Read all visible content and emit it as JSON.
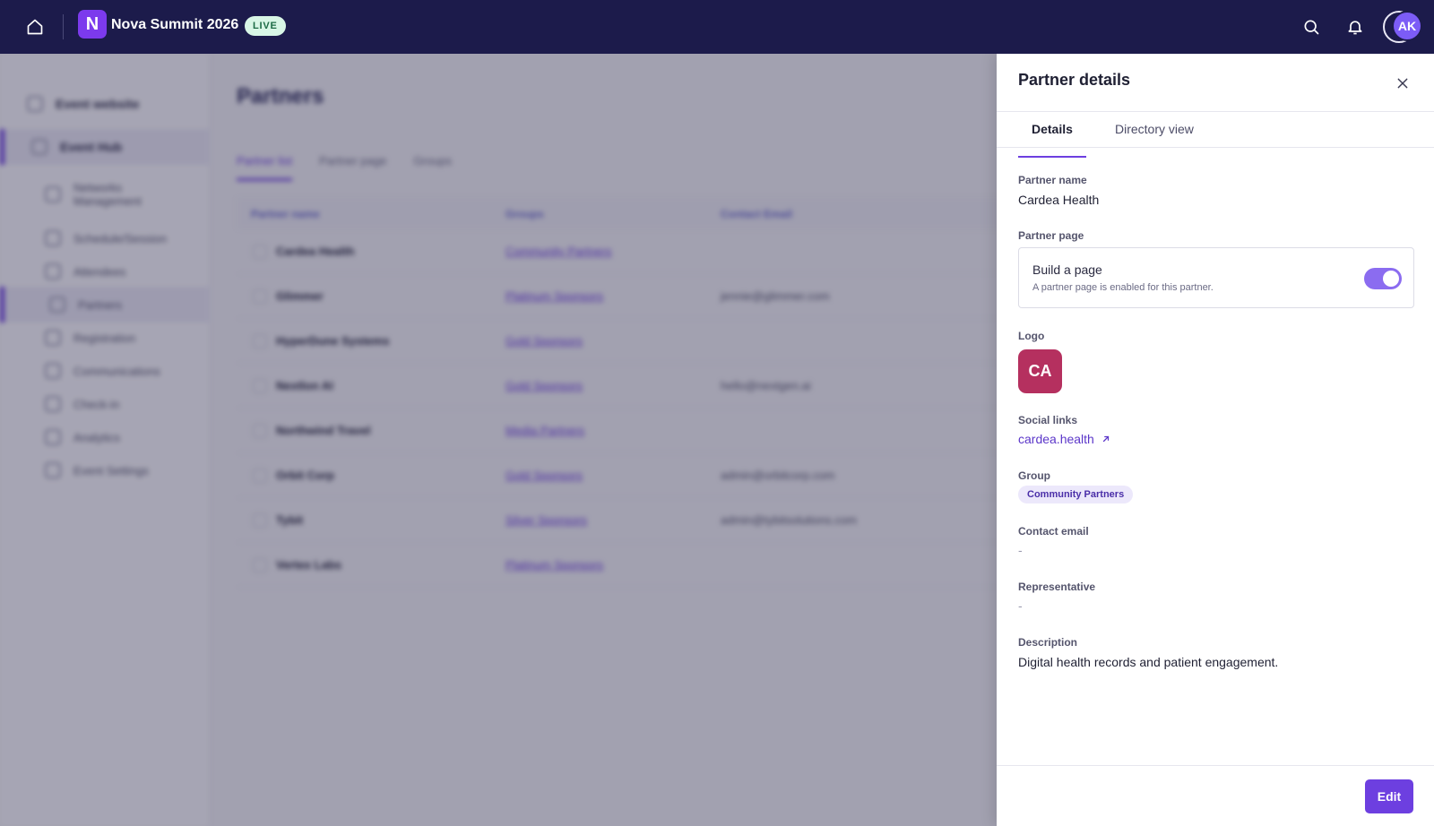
{
  "topbar": {
    "logo_letter": "N",
    "event_name": "Nova Summit 2026",
    "status_badge": "LIVE",
    "avatar_initials": "AK"
  },
  "background": {
    "sidebar": {
      "items": [
        {
          "label": "Event website",
          "level": "top"
        },
        {
          "label": "Event Hub",
          "level": "top",
          "active": true
        },
        {
          "label": "Networks Management",
          "level": "sub"
        },
        {
          "label": "Schedule/Session",
          "level": "sub"
        },
        {
          "label": "Attendees",
          "level": "sub"
        },
        {
          "label": "Partners",
          "level": "sub",
          "active": true
        },
        {
          "label": "Registration",
          "level": "sub"
        },
        {
          "label": "Communications",
          "level": "sub"
        },
        {
          "label": "Check-in",
          "level": "sub"
        },
        {
          "label": "Analytics",
          "level": "sub"
        },
        {
          "label": "Event Settings",
          "level": "sub"
        }
      ]
    },
    "page_title": "Partners",
    "tabs": [
      "Partner list",
      "Partner page",
      "Groups"
    ],
    "table": {
      "columns": [
        "Partner name",
        "Groups",
        "Contact Email"
      ],
      "rows": [
        {
          "name": "Cardea Health",
          "group": "Community Partners",
          "email": ""
        },
        {
          "name": "Glimmer",
          "group": "Platinum Sponsors",
          "email": "jennie@glimmer.com"
        },
        {
          "name": "HyperDune Systems",
          "group": "Gold Sponsors",
          "email": ""
        },
        {
          "name": "Nextlon AI",
          "group": "Gold Sponsors",
          "email": "hello@nextgen.ai"
        },
        {
          "name": "Northwind Travel",
          "group": "Media Partners",
          "email": ""
        },
        {
          "name": "Orbit Corp",
          "group": "Gold Sponsors",
          "email": "admin@orbitcorp.com"
        },
        {
          "name": "Tybit",
          "group": "Silver Sponsors",
          "email": "admin@tybitsolutions.com"
        },
        {
          "name": "Vertex Labs",
          "group": "Platinum Sponsors",
          "email": ""
        }
      ]
    }
  },
  "drawer": {
    "title": "Partner details",
    "tabs": {
      "details": "Details",
      "directory": "Directory view"
    },
    "partner_name_label": "Partner name",
    "partner_name": "Cardea Health",
    "partner_page_label": "Partner page",
    "partner_page_card_title": "Build a page",
    "partner_page_card_desc": "A partner page is enabled for this partner.",
    "partner_page_enabled": true,
    "logo_label": "Logo",
    "logo_initials": "CA",
    "logo_color": "#b5305f",
    "social_links_label": "Social links",
    "social_link": "cardea.health",
    "group_label": "Group",
    "group": "Community Partners",
    "contact_email_label": "Contact email",
    "contact_email": "-",
    "representative_label": "Representative",
    "representative": "-",
    "description_label": "Description",
    "description": "Digital health records and patient engagement.",
    "edit_label": "Edit"
  },
  "colors": {
    "topbar": "#1c1b4b",
    "accent": "#6d3fe0",
    "live_badge_bg": "#d8f6e6"
  },
  "icons": {
    "home": "home-icon",
    "search": "search-icon",
    "notifications": "bell-icon",
    "close": "close-icon",
    "external_link": "arrow-up-right-icon"
  }
}
